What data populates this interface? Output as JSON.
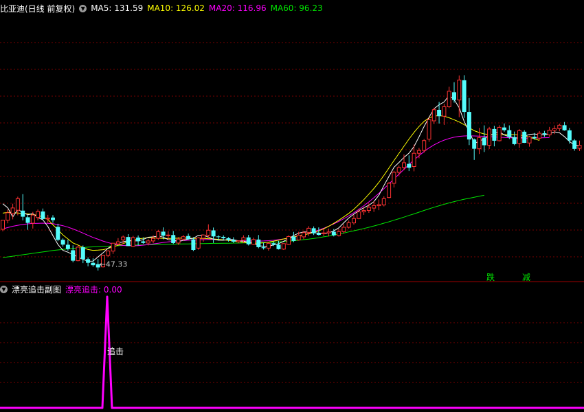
{
  "main_header": {
    "title": "比亚迪(日线 前复权)",
    "ma5": "MA5: 131.59",
    "ma10": "MA10: 126.02",
    "ma20": "MA20: 116.96",
    "ma60": "MA60: 96.23"
  },
  "sub_header": {
    "title": "漂亮追击副图",
    "indicator": "漂亮追击: 0.00"
  },
  "colors": {
    "up": "#ff3232",
    "down": "#54fcfc",
    "ma5": "#ffffff",
    "ma10": "#ffff00",
    "ma20": "#ff00ff",
    "ma60": "#00e600",
    "grid": "#7a0000",
    "signal": "#ff00ff"
  },
  "chart_data": [
    {
      "type": "candlestick",
      "title": "比亚迪(日线 前复权)",
      "ylim": [
        35,
        225
      ],
      "min_label": "47.33",
      "min_value": 47.33,
      "candles": [
        [
          72.1,
          78.5,
          70.7,
          78.5
        ],
        [
          78.5,
          86.1,
          76.3,
          83.8
        ],
        [
          83.2,
          90.2,
          79.1,
          87.2
        ],
        [
          85.6,
          95.2,
          82.0,
          93.8
        ],
        [
          85.3,
          97.0,
          78.4,
          81.0
        ],
        [
          80.6,
          82.0,
          71.7,
          76.6
        ],
        [
          76.4,
          84.4,
          72.6,
          82.2
        ],
        [
          80.4,
          86.1,
          78.4,
          84.7
        ],
        [
          84.7,
          86.8,
          78.4,
          79.4
        ],
        [
          79.4,
          82.3,
          76.6,
          80.0
        ],
        [
          80.4,
          82.1,
          76.7,
          78.6
        ],
        [
          73.8,
          76.0,
          63.6,
          64.6
        ],
        [
          64.6,
          65.6,
          59.8,
          61.2
        ],
        [
          61.1,
          64.6,
          56.8,
          58.1
        ],
        [
          57.2,
          60.7,
          48.6,
          49.8
        ],
        [
          49.8,
          60.8,
          49.3,
          59.4
        ],
        [
          59.3,
          60.6,
          48.1,
          50.9
        ],
        [
          50.9,
          52.1,
          45.8,
          48.3
        ],
        [
          48.3,
          51.5,
          45.5,
          46.6
        ],
        [
          47.3,
          51.0,
          42.8,
          45.0
        ],
        [
          45.4,
          53.8,
          45.0,
          53.5
        ],
        [
          53.5,
          57.2,
          52.4,
          56.7
        ],
        [
          56.6,
          62.2,
          54.6,
          62.2
        ],
        [
          61.7,
          65.8,
          60.7,
          63.2
        ],
        [
          64.6,
          67.7,
          61.6,
          66.6
        ],
        [
          66.6,
          68.6,
          64.0,
          60.2
        ],
        [
          59.9,
          67.4,
          59.4,
          66.2
        ],
        [
          66.2,
          67.7,
          60.6,
          63.6
        ],
        [
          63.5,
          66.3,
          61.8,
          62.4
        ],
        [
          62.3,
          65.1,
          60.6,
          63.8
        ],
        [
          63.8,
          67.8,
          62.3,
          65.6
        ],
        [
          65.6,
          71.6,
          64.6,
          70.4
        ],
        [
          70.4,
          73.4,
          64.9,
          67.5
        ],
        [
          67.5,
          70.8,
          64.4,
          68.0
        ],
        [
          68.0,
          70.9,
          61.6,
          62.3
        ],
        [
          62.3,
          66.5,
          61.0,
          65.1
        ],
        [
          65.1,
          68.0,
          63.9,
          66.8
        ],
        [
          67.3,
          69.0,
          64.7,
          65.1
        ],
        [
          64.9,
          66.5,
          56.6,
          57.4
        ],
        [
          58.7,
          66.5,
          57.6,
          66.0
        ],
        [
          65.8,
          68.3,
          63.3,
          68.0
        ],
        [
          67.9,
          75.6,
          66.2,
          71.4
        ],
        [
          71.3,
          73.3,
          62.4,
          67.0
        ],
        [
          67.0,
          67.8,
          64.0,
          66.7
        ],
        [
          66.7,
          67.8,
          64.3,
          65.8
        ],
        [
          65.8,
          66.4,
          63.4,
          64.6
        ],
        [
          64.6,
          66.4,
          62.4,
          63.3
        ],
        [
          63.2,
          64.2,
          62.2,
          63.9
        ],
        [
          64.4,
          67.8,
          62.3,
          66.1
        ],
        [
          66.3,
          68.1,
          60.6,
          61.4
        ],
        [
          61.4,
          66.2,
          61.0,
          64.8
        ],
        [
          64.8,
          68.0,
          58.6,
          59.4
        ],
        [
          59.3,
          62.6,
          57.7,
          58.7
        ],
        [
          58.7,
          63.3,
          56.9,
          62.1
        ],
        [
          62.2,
          63.4,
          60.2,
          61.2
        ],
        [
          61.2,
          63.8,
          57.7,
          58.0
        ],
        [
          58.0,
          62.1,
          57.4,
          61.9
        ],
        [
          61.3,
          67.8,
          60.9,
          66.9
        ],
        [
          66.9,
          70.2,
          62.9,
          63.8
        ],
        [
          64.5,
          70.3,
          64.0,
          67.9
        ],
        [
          66.7,
          70.7,
          65.1,
          69.7
        ],
        [
          69.9,
          74.3,
          67.3,
          72.8
        ],
        [
          72.8,
          74.1,
          68.0,
          69.2
        ],
        [
          69.2,
          73.4,
          67.6,
          68.1
        ],
        [
          68.9,
          72.3,
          67.2,
          69.5
        ],
        [
          69.5,
          72.6,
          67.1,
          70.2
        ],
        [
          70.3,
          72.3,
          67.0,
          67.8
        ],
        [
          67.6,
          72.4,
          66.9,
          70.4
        ],
        [
          70.4,
          75.7,
          69.0,
          73.5
        ],
        [
          73.5,
          78.3,
          72.6,
          76.7
        ],
        [
          76.6,
          82.4,
          75.4,
          79.7
        ],
        [
          79.7,
          86.8,
          79.2,
          84.4
        ],
        [
          84.4,
          87.5,
          82.3,
          85.4
        ],
        [
          85.4,
          90.4,
          83.7,
          87.7
        ],
        [
          87.1,
          92.0,
          84.4,
          88.9
        ],
        [
          88.8,
          93.2,
          85.6,
          89.6
        ],
        [
          89.4,
          95.4,
          88.3,
          93.8
        ],
        [
          94.6,
          105.6,
          94.1,
          104.7
        ],
        [
          104.7,
          113.6,
          101.7,
          112.5
        ],
        [
          112.5,
          117.3,
          110.2,
          115.9
        ],
        [
          115.9,
          125.2,
          113.9,
          119.3
        ],
        [
          118.5,
          124.5,
          113.4,
          115.7
        ],
        [
          116.6,
          132.2,
          113.2,
          126.0
        ],
        [
          126.0,
          129.8,
          122.5,
          128.0
        ],
        [
          128.0,
          136.1,
          126.4,
          135.0
        ],
        [
          136.0,
          151.6,
          134.1,
          149.8
        ],
        [
          149.0,
          158.4,
          146.8,
          156.9
        ],
        [
          156.8,
          162.4,
          147.1,
          152.3
        ],
        [
          152.3,
          161.1,
          146.1,
          159.0
        ],
        [
          159.0,
          173.2,
          158.1,
          170.0
        ],
        [
          169.3,
          176.4,
          161.9,
          163.8
        ],
        [
          163.8,
          181.2,
          151.6,
          177.9
        ],
        [
          177.8,
          181.4,
          151.1,
          155.3
        ],
        [
          155.3,
          165.2,
          131.8,
          135.8
        ],
        [
          135.8,
          136.5,
          121.3,
          129.2
        ],
        [
          129.2,
          144.0,
          125.5,
          137.1
        ],
        [
          137.1,
          145.8,
          126.9,
          131.7
        ],
        [
          131.7,
          144.7,
          129.0,
          143.2
        ],
        [
          143.2,
          145.5,
          130.9,
          134.9
        ],
        [
          134.9,
          145.9,
          134.4,
          144.4
        ],
        [
          144.3,
          147.2,
          141.3,
          142.4
        ],
        [
          142.4,
          145.8,
          136.1,
          137.5
        ],
        [
          137.5,
          141.4,
          131.7,
          132.5
        ],
        [
          133.0,
          143.1,
          129.8,
          142.0
        ],
        [
          141.3,
          142.4,
          133.3,
          133.4
        ],
        [
          133.3,
          138.4,
          130.7,
          137.7
        ],
        [
          137.7,
          140.4,
          135.7,
          136.6
        ],
        [
          136.7,
          141.7,
          135.3,
          140.2
        ],
        [
          140.2,
          141.9,
          137.7,
          139.5
        ],
        [
          139.1,
          144.7,
          137.8,
          142.4
        ],
        [
          142.4,
          145.8,
          139.6,
          143.5
        ],
        [
          143.5,
          147.0,
          141.6,
          145.9
        ],
        [
          145.9,
          148.2,
          142.0,
          142.3
        ],
        [
          142.3,
          144.0,
          132.8,
          135.1
        ],
        [
          135.1,
          136.1,
          127.8,
          129.1
        ],
        [
          129.5,
          135.0,
          127.6,
          131.6
        ]
      ],
      "ma5": [
        90.2,
        87.3,
        80.8,
        86.1,
        84.1,
        82.3,
        83.2,
        80.4,
        78.8,
        74.0,
        67.6,
        61.3,
        57.1,
        55.8,
        54.1,
        52.4,
        50.7,
        49.4,
        49.5,
        52.5,
        55.4,
        58.7,
        60.8,
        62.3,
        63.2,
        64.0,
        63.9,
        63.8,
        64.8,
        66.4,
        66.7,
        67.2,
        66.5,
        64.7,
        64.5,
        63.4,
        64.2,
        65.2,
        65.7,
        67.8,
        68.1,
        66.4,
        65.1,
        64.4,
        64.3,
        64.9,
        64.7,
        63.8,
        63.6,
        62.8,
        62.1,
        60.4,
        60.1,
        60.0,
        61.0,
        61.9,
        63.5,
        65.4,
        67.7,
        69.3,
        70.2,
        70.1,
        69.6,
        69.4,
        69.0,
        69.6,
        70.9,
        73.1,
        76.7,
        80.1,
        82.8,
        85.3,
        87.4,
        89.1,
        91.7,
        96.3,
        103.1,
        109.6,
        116.0,
        119.5,
        123.1,
        126.1,
        130.8,
        137.7,
        145.0,
        151.6,
        157.6,
        160.4,
        162.4,
        167.1,
        164.1,
        158.3,
        148.6,
        141.4,
        133.3,
        134.2,
        136.6,
        138.2,
        140.1,
        141.3,
        139.0,
        137.7,
        137.2,
        136.6,
        138.0,
        139.4,
        139.7,
        139.2,
        139.0,
        139.8,
        141.2,
        140.5,
        137.8,
        134.4,
        131.7,
        131.6
      ],
      "ma10": [
        83.5,
        84.1,
        83.9,
        83.6,
        83.3,
        83.0,
        82.6,
        81.9,
        80.8,
        79.1,
        75.2,
        71.7,
        68.1,
        65.2,
        62.4,
        60.9,
        59.2,
        57.7,
        57.1,
        57.3,
        57.6,
        58.5,
        59.6,
        60.7,
        61.9,
        63.3,
        64.5,
        65.2,
        65.7,
        66.2,
        66.0,
        65.8,
        65.6,
        65.5,
        65.7,
        65.8,
        65.9,
        65.8,
        65.6,
        65.6,
        65.6,
        65.4,
        65.2,
        64.9,
        64.6,
        64.2,
        63.8,
        63.3,
        62.8,
        62.4,
        62.2,
        62.2,
        62.5,
        63.0,
        63.6,
        64.4,
        65.2,
        65.9,
        66.7,
        67.4,
        68.1,
        68.9,
        69.8,
        70.9,
        72.4,
        74.2,
        76.3,
        78.5,
        80.9,
        83.4,
        86.3,
        89.6,
        93.1,
        97.0,
        101.0,
        105.4,
        110.3,
        115.6,
        120.8,
        125.9,
        131.0,
        136.1,
        140.8,
        145.0,
        148.6,
        151.1,
        152.4,
        152.7,
        152.3,
        151.2,
        149.8,
        148.2,
        146.3,
        144.2,
        142.0,
        140.7,
        139.7,
        139.3,
        139.1,
        139.1,
        139.2,
        139.3,
        139.2,
        139.0,
        138.4,
        137.5,
        136.3,
        135.1
      ],
      "ma20": [
        72.3,
        73.3,
        74.2,
        74.9,
        75.5,
        75.9,
        76.2,
        76.3,
        76.4,
        76.3,
        76.0,
        75.4,
        74.6,
        73.6,
        72.3,
        70.9,
        69.4,
        67.8,
        66.3,
        65.0,
        63.7,
        62.6,
        61.7,
        61.0,
        60.6,
        60.4,
        60.4,
        60.5,
        60.8,
        61.2,
        61.7,
        62.2,
        62.7,
        63.1,
        63.5,
        63.8,
        64.1,
        64.3,
        64.5,
        64.6,
        64.7,
        64.8,
        64.8,
        64.7,
        64.6,
        64.4,
        64.2,
        64.0,
        63.9,
        63.8,
        63.7,
        63.7,
        63.8,
        64.0,
        64.3,
        64.7,
        65.2,
        65.8,
        66.5,
        67.3,
        68.2,
        69.2,
        70.3,
        71.5,
        72.8,
        74.3,
        75.9,
        77.7,
        79.6,
        81.6,
        83.8,
        86.2,
        88.8,
        91.5,
        94.5,
        97.6,
        100.9,
        104.3,
        107.7,
        111.2,
        114.6,
        118.0,
        121.3,
        124.3,
        127.2,
        129.8,
        132.0,
        133.8,
        135.3,
        136.5,
        137.4,
        138.0,
        138.3,
        138.4,
        138.3,
        138.2,
        138.0,
        137.8,
        137.6,
        137.4,
        137.2,
        137.0,
        136.8,
        136.7,
        136.7,
        136.7,
        136.8,
        136.9,
        137.0,
        137.1
      ],
      "ma60": [
        52.0,
        52.5,
        53.0,
        53.5,
        54.0,
        54.5,
        55.0,
        55.5,
        56.0,
        56.5,
        57.0,
        57.4,
        57.8,
        58.2,
        58.5,
        58.8,
        59.1,
        59.4,
        59.6,
        59.8,
        60.0,
        60.1,
        60.3,
        60.4,
        60.6,
        60.7,
        60.8,
        60.9,
        61.0,
        61.1,
        61.2,
        61.3,
        61.4,
        61.5,
        61.5,
        61.6,
        61.7,
        61.7,
        61.8,
        61.9,
        61.9,
        62.0,
        62.1,
        62.1,
        62.2,
        62.2,
        62.3,
        62.3,
        62.4,
        62.5,
        62.5,
        62.6,
        62.7,
        62.8,
        62.9,
        63.1,
        63.3,
        63.6,
        63.9,
        64.3,
        64.7,
        65.1,
        65.6,
        66.1,
        66.7,
        67.3,
        68.0,
        68.7,
        69.4,
        70.2,
        71.0,
        71.8,
        72.6,
        73.5,
        74.4,
        75.4,
        76.4,
        77.4,
        78.5,
        79.6,
        80.7,
        81.9,
        83.0,
        84.2,
        85.4,
        86.6,
        87.7,
        88.8,
        89.8,
        90.8,
        91.7,
        92.6,
        93.4,
        94.1,
        94.8,
        95.5,
        96.2
      ]
    },
    {
      "type": "line",
      "title": "漂亮追击副图",
      "series_name": "漂亮追击",
      "spike_label": "追击",
      "x": [
        0,
        1,
        2,
        3,
        4,
        5,
        6,
        7,
        8,
        9,
        10,
        11,
        12,
        13,
        14,
        15,
        16,
        17,
        18,
        19,
        20,
        21
      ],
      "values": [
        0,
        0,
        0,
        0,
        0,
        0,
        0,
        0,
        0,
        0,
        0,
        0,
        0,
        0,
        0,
        0,
        0,
        0,
        0,
        1,
        0,
        0
      ]
    }
  ],
  "signals": [
    "跌",
    "减"
  ]
}
